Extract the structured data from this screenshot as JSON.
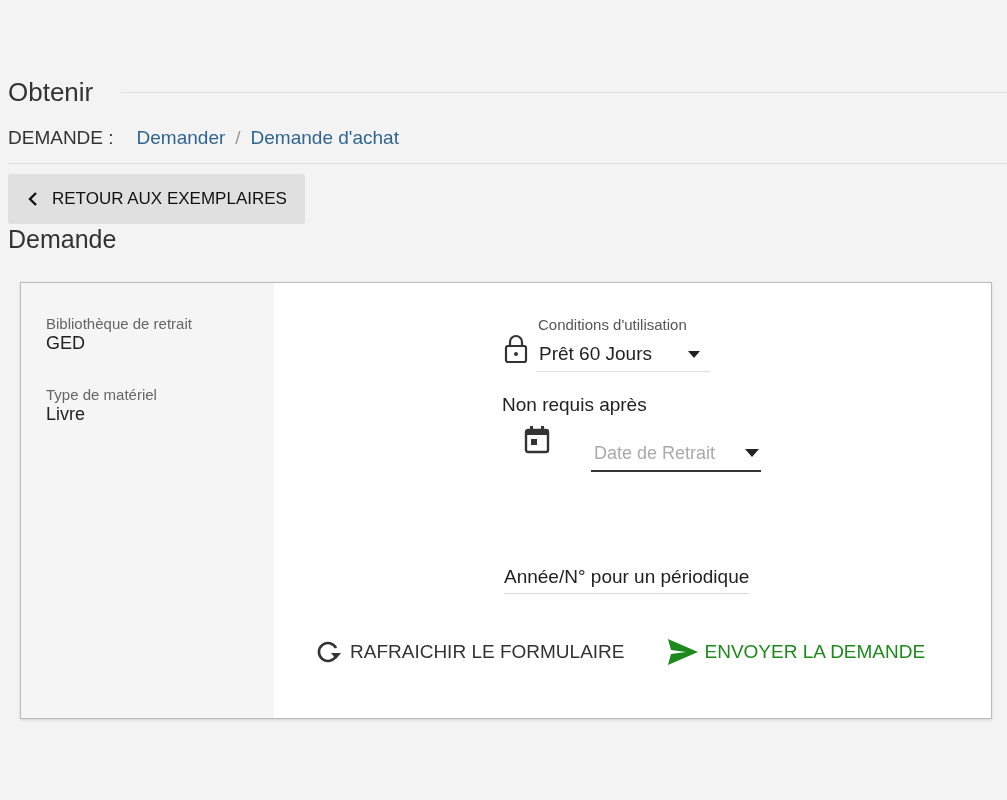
{
  "section_title": "Obtenir",
  "breadcrumb": {
    "label": "DEMANDE :",
    "separator": "/",
    "items": [
      {
        "label": "Demander"
      },
      {
        "label": "Demande d'achat"
      }
    ]
  },
  "back_button": {
    "label": "RETOUR AUX EXEMPLAIRES"
  },
  "heading": "Demande",
  "details": [
    {
      "label": "Bibliothèque de retrait",
      "value": "GED"
    },
    {
      "label": "Type de matériel",
      "value": "Livre"
    }
  ],
  "form": {
    "conditions": {
      "label": "Conditions d'utilisation",
      "value": "Prêt 60 Jours"
    },
    "not_required_label": "Non requis après",
    "date": {
      "placeholder": "Date de Retrait"
    },
    "periodical": {
      "placeholder": "Année/N° pour un périodique"
    }
  },
  "actions": [
    {
      "kind": "refresh",
      "label": "RAFRAICHIR LE FORMULAIRE"
    },
    {
      "kind": "send",
      "label": "ENVOYER LA DEMANDE"
    }
  ]
}
